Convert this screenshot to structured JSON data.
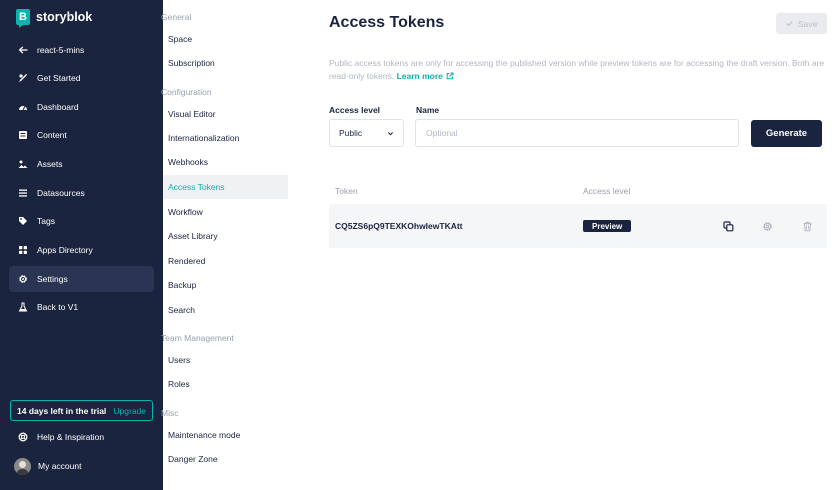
{
  "brand": {
    "name": "storyblok",
    "logo_letter": "B"
  },
  "sidebar": {
    "items": [
      {
        "icon": "arrow-left-icon",
        "label": "react-5-mins"
      },
      {
        "icon": "rocket-icon",
        "label": "Get Started"
      },
      {
        "icon": "dashboard-icon",
        "label": "Dashboard"
      },
      {
        "icon": "content-icon",
        "label": "Content"
      },
      {
        "icon": "assets-icon",
        "label": "Assets"
      },
      {
        "icon": "datasources-icon",
        "label": "Datasources"
      },
      {
        "icon": "tag-icon",
        "label": "Tags"
      },
      {
        "icon": "apps-icon",
        "label": "Apps Directory"
      },
      {
        "icon": "gear-icon",
        "label": "Settings",
        "active": true
      },
      {
        "icon": "flask-icon",
        "label": "Back to V1"
      }
    ],
    "trial": {
      "text": "14 days left in the trial",
      "upgrade": "Upgrade"
    },
    "help": {
      "icon": "lifebuoy-icon",
      "label": "Help & Inspiration"
    },
    "account": {
      "label": "My account"
    }
  },
  "subnav": {
    "sections": [
      {
        "label": "General"
      },
      {
        "label": "Configuration"
      },
      {
        "label": "Team Management"
      },
      {
        "label": "Misc"
      }
    ],
    "items": [
      {
        "label": "Space"
      },
      {
        "label": "Subscription"
      },
      {
        "label": "Visual Editor"
      },
      {
        "label": "Internationalization"
      },
      {
        "label": "Webhooks"
      },
      {
        "label": "Access Tokens",
        "active": true
      },
      {
        "label": "Workflow"
      },
      {
        "label": "Asset Library"
      },
      {
        "label": "Rendered"
      },
      {
        "label": "Backup"
      },
      {
        "label": "Search"
      },
      {
        "label": "Users"
      },
      {
        "label": "Roles"
      },
      {
        "label": "Maintenance mode"
      },
      {
        "label": "Danger Zone"
      }
    ]
  },
  "main": {
    "title": "Access Tokens",
    "save_label": "Save",
    "description": "Public access tokens are only for accessing the published version while preview tokens are for accessing the draft version. Both are read-only tokens.",
    "learn_more": "Learn more",
    "access_level_label": "Access level",
    "access_level_value": "Public",
    "name_label": "Name",
    "name_placeholder": "Optional",
    "name_value": "",
    "generate_label": "Generate",
    "table": {
      "headers": [
        "Token",
        "Access level"
      ],
      "rows": [
        {
          "token": "CQ5ZS6pQ9TEXKOhwIewTKAtt",
          "access_level": "Preview"
        }
      ]
    }
  },
  "colors": {
    "sidebar_bg": "#1b243f",
    "accent": "#09b3af",
    "active_bg": "#2a3453"
  }
}
